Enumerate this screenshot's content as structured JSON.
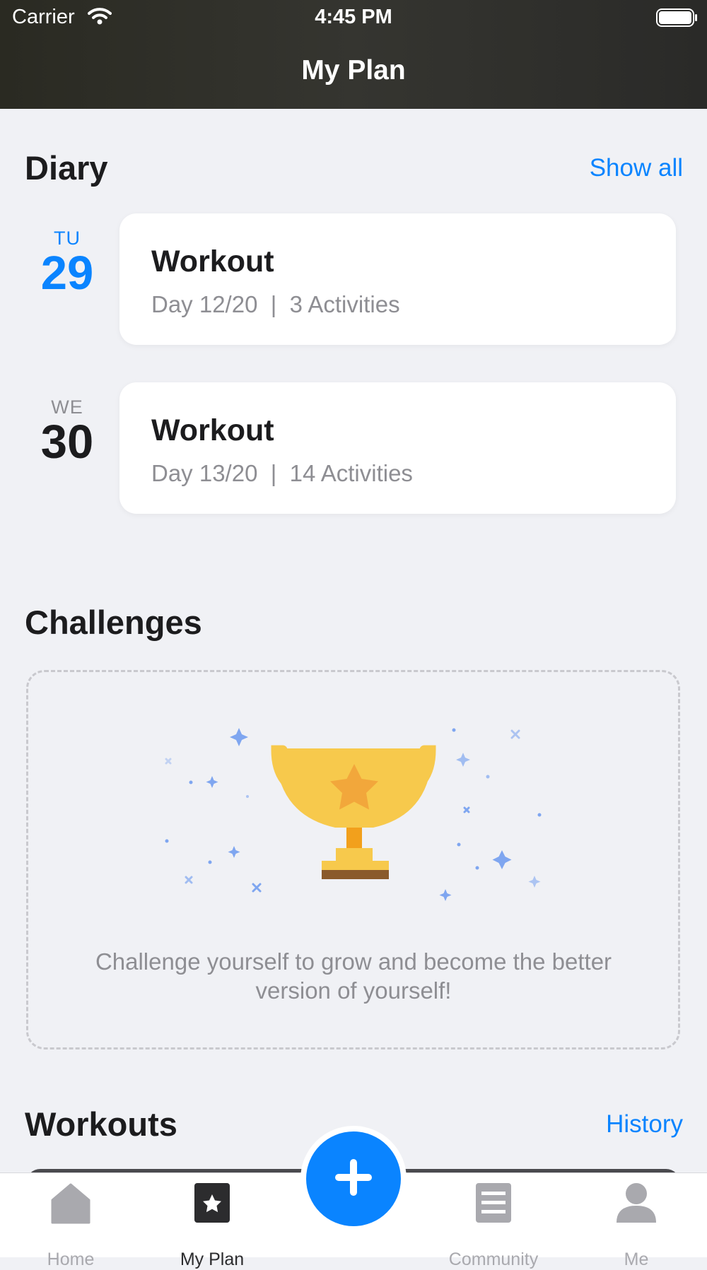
{
  "status_bar": {
    "carrier": "Carrier",
    "time": "4:45 PM"
  },
  "nav": {
    "title": "My Plan"
  },
  "diary": {
    "title": "Diary",
    "link": "Show all",
    "entries": [
      {
        "day": "TU",
        "date": "29",
        "title": "Workout",
        "subtitle": "Day 12/20  |  3 Activities",
        "selected": true
      },
      {
        "day": "WE",
        "date": "30",
        "title": "Workout",
        "subtitle": "Day 13/20  |  14 Activities",
        "selected": false
      }
    ]
  },
  "challenges": {
    "title": "Challenges",
    "empty_text": "Challenge yourself to grow and become the better version of yourself!",
    "illustration": "trophy-icon"
  },
  "workouts": {
    "title": "Workouts",
    "link": "History"
  },
  "tabbar": {
    "items": [
      {
        "label": "Home",
        "icon": "home-icon",
        "active": false
      },
      {
        "label": "My Plan",
        "icon": "star-square-icon",
        "active": true
      },
      {
        "label": "Community",
        "icon": "document-icon",
        "active": false
      },
      {
        "label": "Me",
        "icon": "person-icon",
        "active": false
      }
    ],
    "fab_icon": "plus-icon"
  },
  "colors": {
    "accent": "#0a84ff",
    "background": "#f0f1f5",
    "header": "#2f2f2b",
    "inactive": "#8e8e93",
    "trophy": "#f7c94c"
  }
}
